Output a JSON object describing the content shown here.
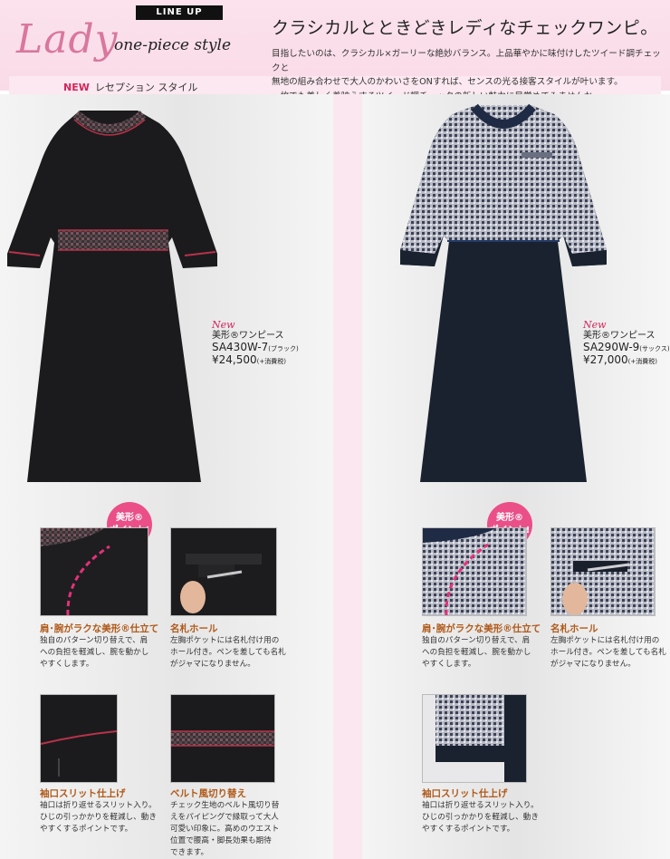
{
  "header": {
    "lineup": "LINE UP",
    "lady": "Lady",
    "one_piece_style": "one-piece style",
    "new": "NEW",
    "reception_style": "レセプション スタイル",
    "headline": "クラシカルとときどきレディなチェックワンピ。",
    "description": [
      "目指したいのは、クラシカル×ガーリーな絶妙バランス。上品華やかに味付けしたツイード調チェックと",
      "無地の組み合わせで大人のかわいさをONすれば、センスの光る接客スタイルが叶います。",
      "一枚でも美しく着映えするツイード調チェックの新しい魅力に目覚めてみませんか。"
    ]
  },
  "products": [
    {
      "new": "New",
      "name": "美形®ワンピース",
      "code": "SA430W-7",
      "color": "(ブラック)",
      "price": "¥24,500",
      "tax": "(+消費税)"
    },
    {
      "new": "New",
      "name": "美形®ワンピース",
      "code": "SA290W-9",
      "color": "(サックス)",
      "price": "¥27,000",
      "tax": "(+消費税)"
    }
  ],
  "badge": {
    "line1": "美形®",
    "line2": "ポイント!"
  },
  "features_left": [
    {
      "title": "肩･腕がラクな美形®仕立て",
      "desc": [
        "独自のパターン切り替えで、肩",
        "への負担を軽減し、腕を動かし",
        "やすくします。"
      ]
    },
    {
      "title": "名札ホール",
      "desc": [
        "左胸ポケットには名札付け用の",
        "ホール付き。ペンを差しても名札",
        "がジャマになりません。"
      ]
    },
    {
      "title": "袖口スリット仕上げ",
      "desc": [
        "袖口は折り返せるスリット入り。",
        "ひじの引っかかりを軽減し、動き",
        "やすくするポイントです。"
      ]
    },
    {
      "title": "ベルト風切り替え",
      "desc": [
        "チェック生地のベルト風切り替",
        "えをパイピングで縁取って大人",
        "可愛い印象に。高めのウエスト",
        "位置で腰高・脚長効果も期待",
        "できます。"
      ]
    }
  ],
  "features_right": [
    {
      "title": "肩･腕がラクな美形®仕立て",
      "desc": [
        "独自のパターン切り替えで、肩",
        "への負担を軽減し、腕を動かし",
        "やすくします。"
      ]
    },
    {
      "title": "名札ホール",
      "desc": [
        "左胸ポケットには名札付け用の",
        "ホール付き。ペンを差しても名札",
        "がジャマになりません。"
      ]
    },
    {
      "title": "袖口スリット仕上げ",
      "desc": [
        "袖口は折り返せるスリット入り。",
        "ひじの引っかかりを軽減し、動き",
        "やすくするポイントです。"
      ]
    }
  ],
  "colors": {
    "pink": "#ea4f88",
    "brand_pink": "#d0265c",
    "feature_title": "#b05a1a",
    "dress_black": "#1b1b1d",
    "dress_navy": "#1a2230",
    "piping_red": "#b8324a",
    "piping_navy": "#243a66"
  }
}
